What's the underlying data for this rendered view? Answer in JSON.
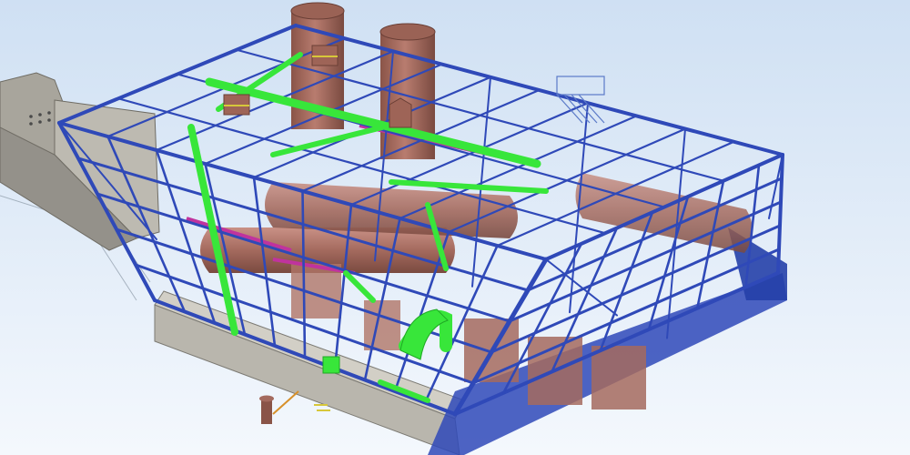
{
  "viewport": {
    "background_top": "#cfe0f3",
    "background_bottom": "#f4f8fd"
  },
  "colors": {
    "steel_frame": "#2f49b8",
    "steel_frame_dark": "#1f3590",
    "piping_green": "#38e63a",
    "piping_green_dark": "#1fa824",
    "vessel_brown": "#a76b5f",
    "vessel_brown_light": "#c99186",
    "foundation_gray": "#b9b6ad",
    "duct_gray": "#a8a59c",
    "accent_magenta": "#c0339e",
    "accent_yellow": "#d7c73a"
  },
  "objects": [
    {
      "name": "steel-structure",
      "kind": "structural frame"
    },
    {
      "name": "stack-left",
      "kind": "exhaust stack"
    },
    {
      "name": "stack-right",
      "kind": "exhaust stack"
    },
    {
      "name": "inlet-duct",
      "kind": "duct"
    },
    {
      "name": "green-piping",
      "kind": "pipe rack"
    },
    {
      "name": "drum-vessels",
      "kind": "vessel"
    },
    {
      "name": "concrete-foundation",
      "kind": "slab"
    },
    {
      "name": "stair-platform",
      "kind": "access platform"
    },
    {
      "name": "loose-item-bollard",
      "kind": "component"
    }
  ]
}
